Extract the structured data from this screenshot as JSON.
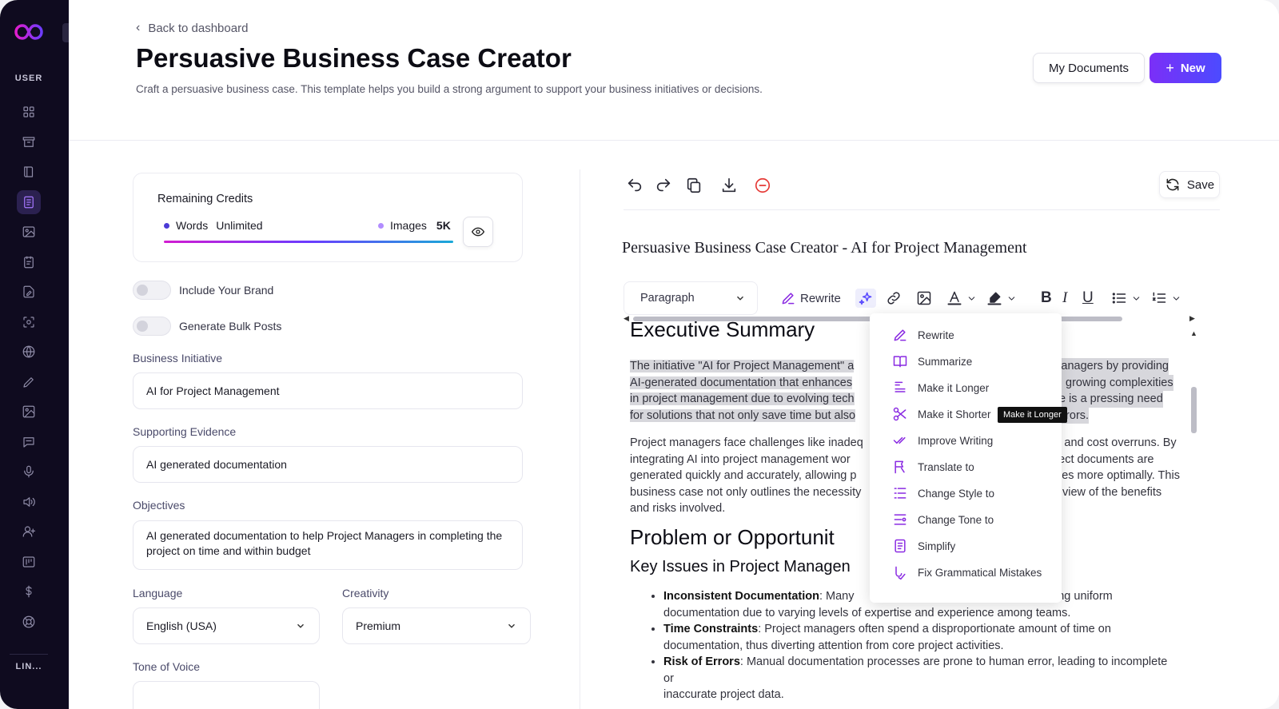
{
  "sidebar": {
    "section_user": "USER",
    "section_links": "LIN...",
    "icons": [
      "grid-icon",
      "archive-icon",
      "book-icon",
      "document-icon",
      "image-icon",
      "note-icon",
      "file-edit-icon",
      "scan-icon",
      "globe-icon",
      "pen-icon",
      "gallery-icon",
      "chat-icon",
      "microphone-icon",
      "speaker-icon",
      "user-plus-icon",
      "board-icon",
      "dollar-icon",
      "support-icon"
    ],
    "active_index": 3,
    "accent": "#a778ff"
  },
  "header": {
    "back_label": "Back to dashboard",
    "title": "Persuasive Business Case Creator",
    "description": "Craft a persuasive business case. This template helps you build a strong argument to support your business initiatives or decisions.",
    "my_documents": "My Documents",
    "new_button": "New"
  },
  "credits": {
    "title": "Remaining Credits",
    "words_label": "Words",
    "words_value": "Unlimited",
    "images_label": "Images",
    "images_value": "5K"
  },
  "form": {
    "include_brand": "Include Your Brand",
    "bulk_posts": "Generate Bulk Posts",
    "business_initiative_label": "Business Initiative",
    "business_initiative_value": "AI for Project Management",
    "supporting_evidence_label": "Supporting Evidence",
    "supporting_evidence_value": "AI generated documentation",
    "objectives_label": "Objectives",
    "objectives_value": "AI generated documentation to help Project Managers in completing the project on time and within budget",
    "language_label": "Language",
    "language_value": "English (USA)",
    "creativity_label": "Creativity",
    "creativity_value": "Premium",
    "tone_label": "Tone of Voice"
  },
  "editor": {
    "save": "Save",
    "doc_title": "Persuasive Business Case Creator - AI for Project Management",
    "paragraph_select": "Paragraph",
    "rewrite": "Rewrite",
    "h1": "Executive Summary",
    "p1_lines": [
      "The initiative \"AI for Project Management\" a",
      "AI-generated documentation that enhances",
      "in project management due to evolving tech",
      "for solutions that not only save time but also"
    ],
    "p1_right_lines": [
      "ct managers by providing",
      "With growing complexities",
      "there is a pressing need",
      "an errors."
    ],
    "p2_lines": [
      "Project managers face challenges like inadeq",
      "integrating AI into project management wor",
      "generated quickly and accurately, allowing p",
      "business case not only outlines the necessity",
      "and risks involved."
    ],
    "p2_right_lines": [
      "nes, and cost overruns. By",
      "project documents are",
      "ources more optimally. This",
      "istic view of the benefits",
      ""
    ],
    "h2": "Problem or Opportunit",
    "h3": "Key Issues in Project Managen",
    "bullets": [
      {
        "bold": "Inconsistent Documentation",
        "text": ": Many ",
        "rest": "ing uniform",
        "line2": "documentation due to varying levels of expertise and experience among teams."
      },
      {
        "bold": "Time Constraints",
        "text": ": Project managers often spend a disproportionate amount of time on",
        "rest": "",
        "line2": "documentation, thus diverting attention from core project activities."
      },
      {
        "bold": "Risk of Errors",
        "text": ": Manual documentation processes are prone to human error, leading to incomplete or",
        "rest": "",
        "line2": "inaccurate project data."
      }
    ]
  },
  "ai_menu": {
    "items": [
      "Rewrite",
      "Summarize",
      "Make it Longer",
      "Make it Shorter",
      "Improve Writing",
      "Translate to",
      "Change Style to",
      "Change Tone to",
      "Simplify",
      "Fix Grammatical Mistakes"
    ],
    "tooltip": "Make it Longer"
  }
}
